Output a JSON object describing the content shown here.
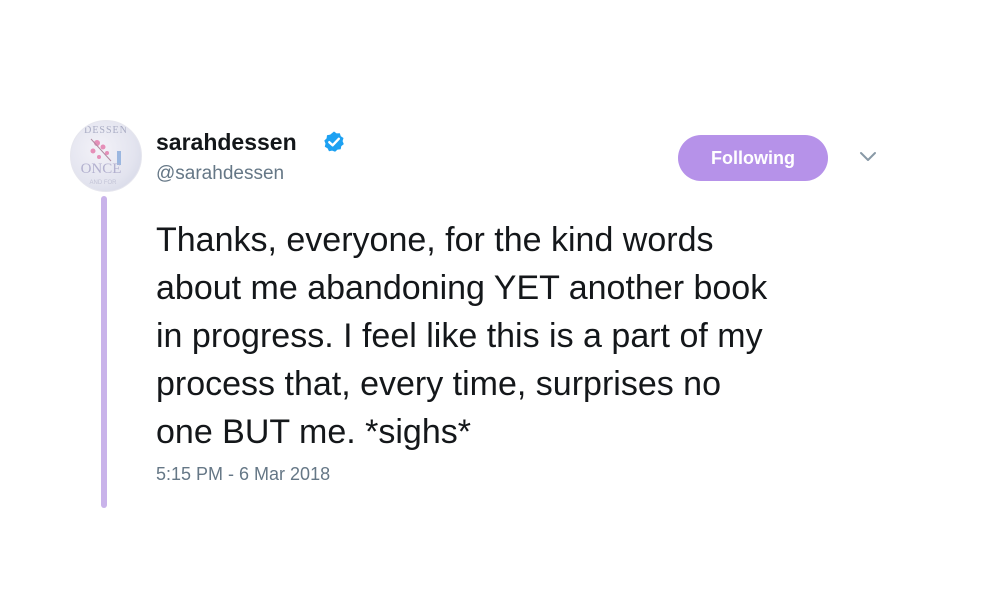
{
  "author": {
    "display_name": "sarahdessen",
    "handle": "@sarahdessen",
    "verified": true,
    "avatar_text": [
      "DESSEN",
      "ONCE",
      "AND FOR"
    ]
  },
  "follow_button": {
    "label": "Following",
    "color": "#b692e9"
  },
  "menu_icon": "chevron-down-icon",
  "tweet": {
    "lines": [
      "Thanks, everyone, for the kind words",
      "about me abandoning YET another book",
      "in progress. I feel like this is a part of my",
      "process that, every time, surprises no",
      "one BUT me. *sighs*"
    ],
    "timestamp": "5:15 PM - 6 Mar 2018"
  },
  "colors": {
    "thread_line": "#c9b3ea",
    "verified_badge": "#1da1f2",
    "secondary_text": "#657786"
  }
}
